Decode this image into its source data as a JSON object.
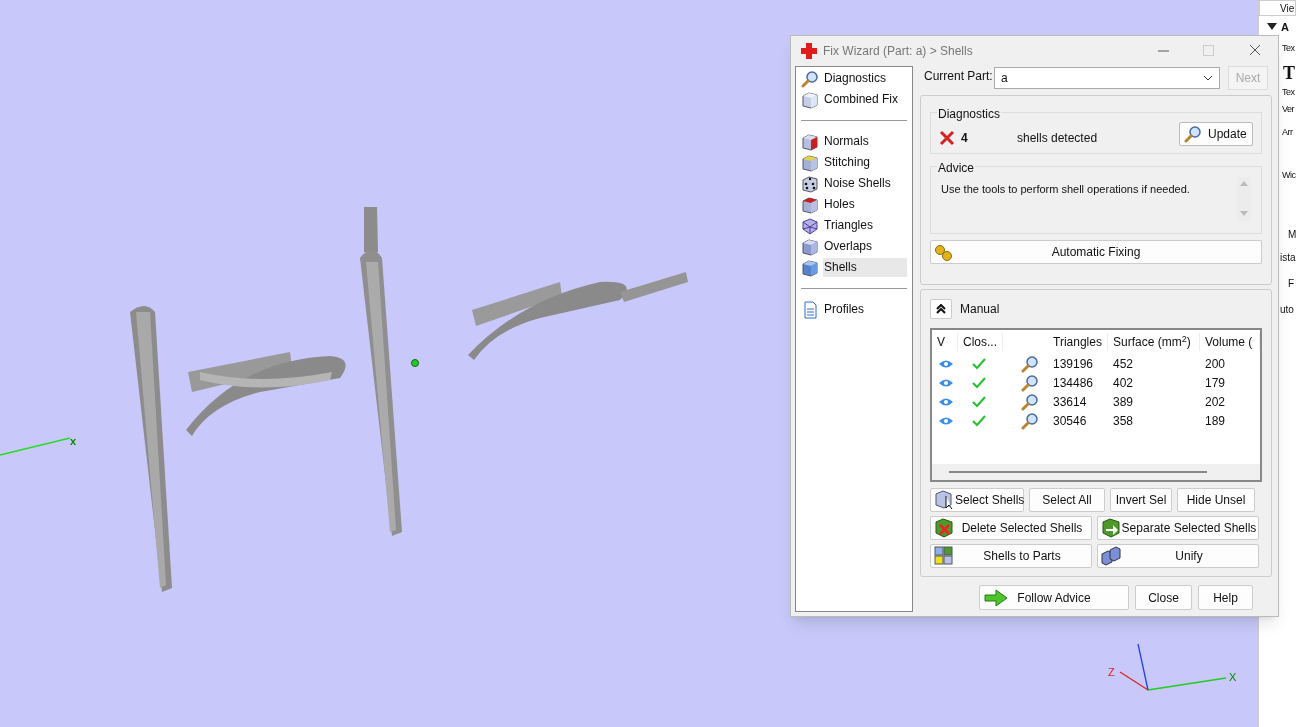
{
  "viewport": {
    "axis_labels": [
      {
        "kind": "x",
        "text": "x"
      },
      {
        "kind": "z",
        "text": "Z"
      },
      {
        "kind": "x2",
        "text": "X"
      }
    ]
  },
  "side_panel": {
    "items": [
      "Vie",
      "A",
      "Tex",
      "T",
      "Tex",
      "Ver",
      "Arr",
      "Wic",
      "M",
      "ista",
      "F",
      "uto"
    ]
  },
  "dialog": {
    "title": "Fix Wizard (Part: a) > Shells",
    "nav": [
      [
        {
          "label": "Diagnostics",
          "selected": false
        },
        {
          "label": "Combined Fix",
          "selected": false
        }
      ],
      [
        {
          "label": "Normals",
          "selected": false
        },
        {
          "label": "Stitching",
          "selected": false
        },
        {
          "label": "Noise Shells",
          "selected": false
        },
        {
          "label": "Holes",
          "selected": false
        },
        {
          "label": "Triangles",
          "selected": false
        },
        {
          "label": "Overlaps",
          "selected": false
        },
        {
          "label": "Shells",
          "selected": true
        }
      ],
      [
        {
          "label": "Profiles",
          "selected": false
        }
      ]
    ],
    "current_part": {
      "label": "Current Part:",
      "value": "a"
    },
    "next_button": {
      "label": "Next",
      "disabled": true
    },
    "diagnostics": {
      "title": "Diagnostics",
      "count": "4",
      "text": "shells detected",
      "update_button": "Update"
    },
    "advice": {
      "title": "Advice",
      "text": "Use the tools to perform shell operations if needed."
    },
    "automatic_fixing": "Automatic Fixing",
    "manual": {
      "title": "Manual",
      "columns": [
        "V",
        "Clos...",
        "",
        "Triangles",
        "Surface (mm$^{2}$)",
        "Volume ("
      ],
      "rows": [
        {
          "visible": true,
          "closed": true,
          "triangles": "139196",
          "surface": "452",
          "volume": "200"
        },
        {
          "visible": true,
          "closed": true,
          "triangles": "134486",
          "surface": "402",
          "volume": "179"
        },
        {
          "visible": true,
          "closed": true,
          "triangles": "33614",
          "surface": "389",
          "volume": "202"
        },
        {
          "visible": true,
          "closed": true,
          "triangles": "30546",
          "surface": "358",
          "volume": "189"
        }
      ],
      "buttons": [
        [
          "Select Shells",
          "Select All",
          "Invert Sel",
          "Hide Unsel"
        ],
        [
          "Delete Selected Shells",
          "Separate Selected Shells"
        ],
        [
          "Shells to Parts",
          "Unify"
        ]
      ]
    },
    "footer_buttons": [
      "Follow Advice",
      "Close",
      "Help"
    ]
  }
}
